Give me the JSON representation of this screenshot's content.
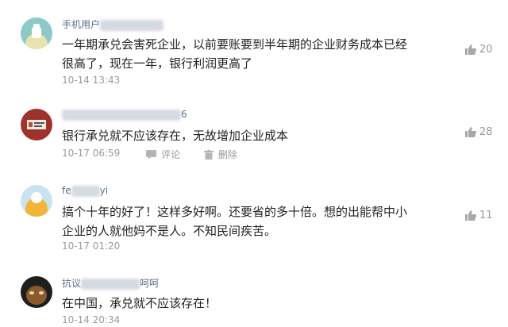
{
  "comments": [
    {
      "user_visible": "手机用户",
      "user_suffix": "",
      "text_line1": "一年期承兑会害死企业，以前要账要到半年期的企业财务成本已经",
      "text_line2": "很高了，现在一年，银行利润更高了",
      "time": "10-14 13:43",
      "likes": "20"
    },
    {
      "user_visible": "",
      "user_suffix": "6",
      "text_line1": "银行承兑就不应该存在，无故增加企业成本",
      "time": "10-17 06:59",
      "likes": "28",
      "actions": {
        "comment": "评论",
        "delete": "删除"
      }
    },
    {
      "user_visible": "fe",
      "user_suffix": "yi",
      "text_line1": "搞个十年的好了！这样多好啊。还要省的多十倍。想的出能帮中小",
      "text_line2": "企业的人就他妈不是人。不知民间疾苦。",
      "time": "10-17 01:20",
      "likes": "11"
    },
    {
      "user_visible": "抗议",
      "user_suffix": "呵呵",
      "text_line1": "在中国，承兑就不应该存在！",
      "time": "10-14 20:34"
    }
  ]
}
